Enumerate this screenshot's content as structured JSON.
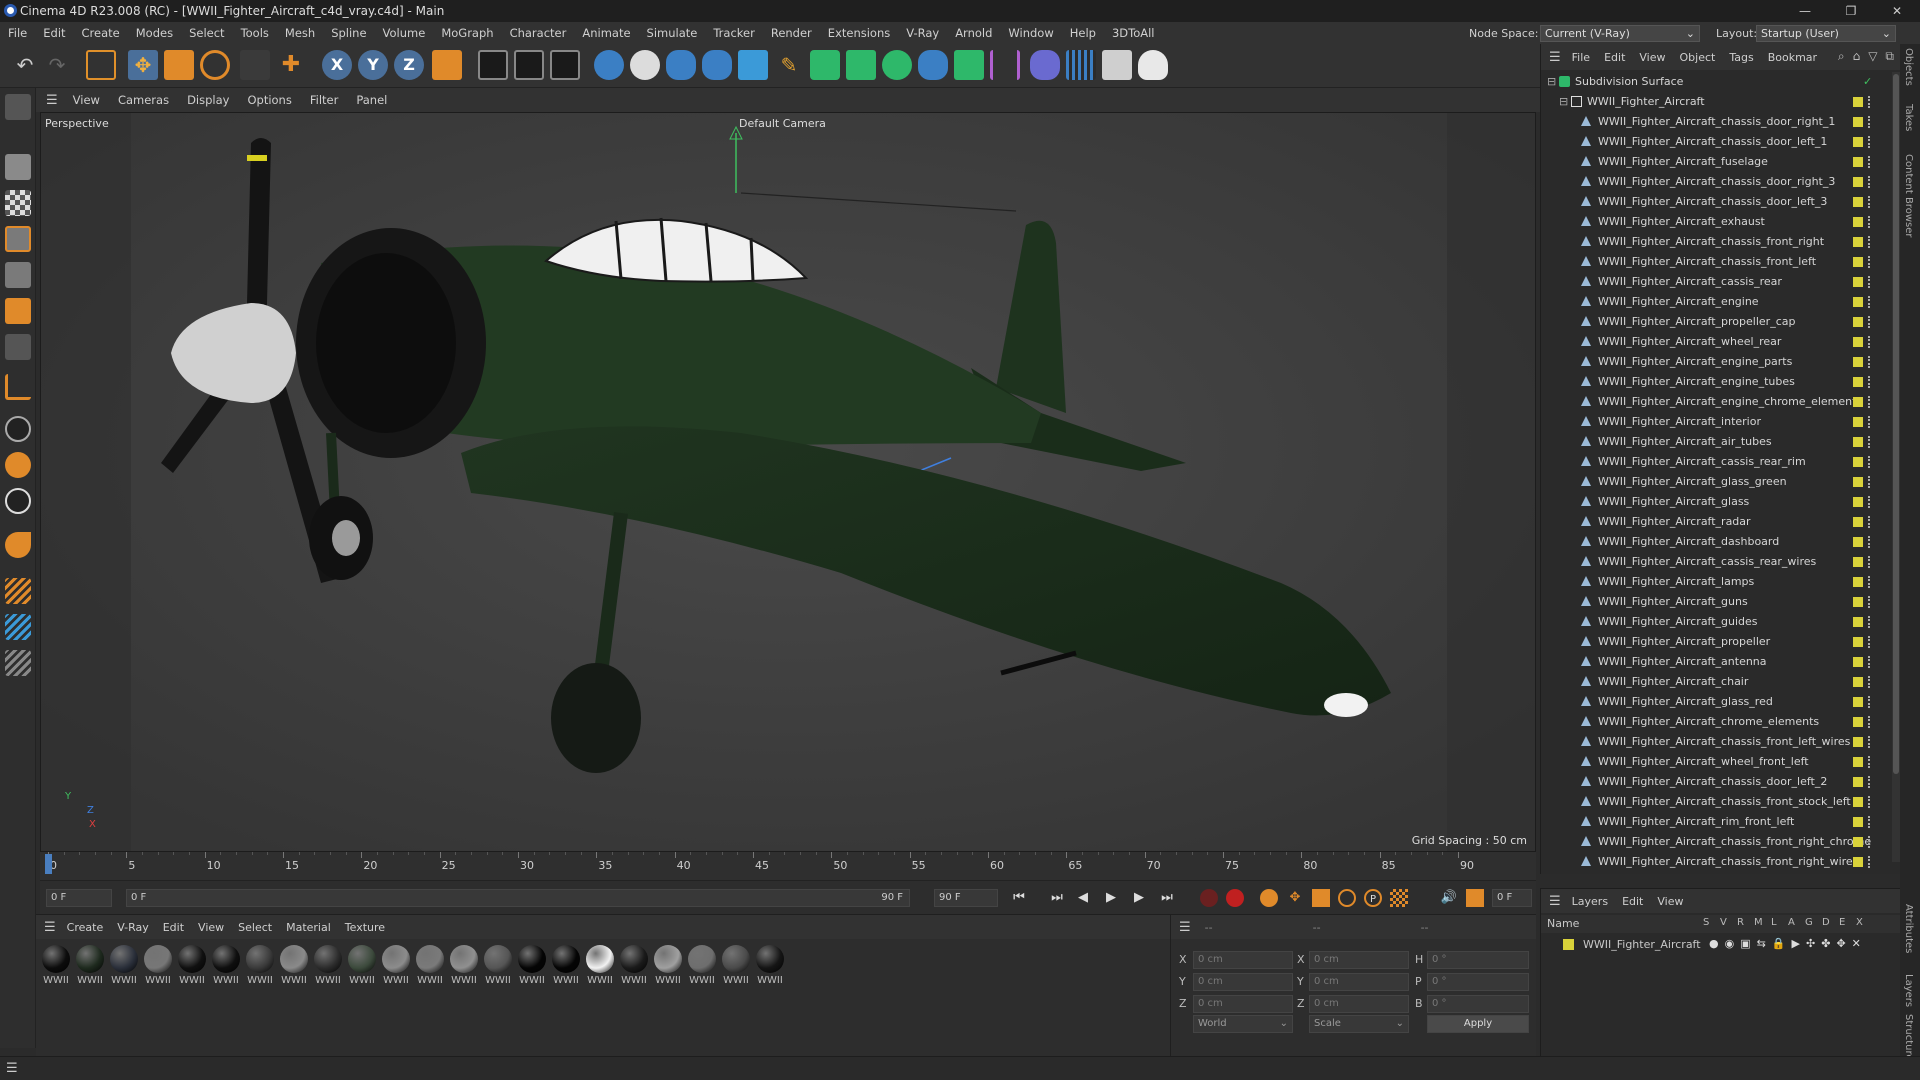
{
  "window": {
    "title": "Cinema 4D R23.008 (RC) - [WWII_Fighter_Aircraft_c4d_vray.c4d] - Main",
    "minimize": "—",
    "maximize": "❐",
    "close": "✕"
  },
  "menubar": {
    "items": [
      "File",
      "Edit",
      "Create",
      "Modes",
      "Select",
      "Tools",
      "Mesh",
      "Spline",
      "Volume",
      "MoGraph",
      "Character",
      "Animate",
      "Simulate",
      "Tracker",
      "Render",
      "Extensions",
      "V-Ray",
      "Arnold",
      "Window",
      "Help",
      "3DToAll"
    ],
    "node_space_label": "Node Space:",
    "node_space_value": "Current (V-Ray)",
    "layout_label": "Layout:",
    "layout_value": "Startup (User)"
  },
  "viewport": {
    "menu": [
      "View",
      "Cameras",
      "Display",
      "Options",
      "Filter",
      "Panel"
    ],
    "view_name": "Perspective",
    "camera_name": "Default Camera",
    "grid_spacing": "Grid Spacing : 50 cm",
    "axis_y": "Y",
    "axis_z": "Z",
    "axis_x": "X"
  },
  "timeline": {
    "ticks": [
      "0",
      "5",
      "10",
      "15",
      "20",
      "25",
      "30",
      "35",
      "40",
      "45",
      "50",
      "55",
      "60",
      "65",
      "70",
      "75",
      "80",
      "85",
      "90"
    ],
    "current_frame": "0 F",
    "start_field": "0 F",
    "range_start": "0 F",
    "range_end": "90 F",
    "end_field": "90 F",
    "max_field": "0 F",
    "playhead_fraction": 0
  },
  "materials": {
    "menu": [
      "Create",
      "V-Ray",
      "Edit",
      "View",
      "Select",
      "Material",
      "Texture"
    ],
    "items": [
      {
        "label": "WWII",
        "color": "#0c0c0c"
      },
      {
        "label": "WWII",
        "color": "#1e2a1e"
      },
      {
        "label": "WWII",
        "color": "#2a2f3a"
      },
      {
        "label": "WWII",
        "color": "#777777"
      },
      {
        "label": "WWII",
        "color": "#101010"
      },
      {
        "label": "WWII",
        "color": "#0f0f0f"
      },
      {
        "label": "WWII",
        "color": "#3a3a3a"
      },
      {
        "label": "WWII",
        "color": "#8a8a8a"
      },
      {
        "label": "WWII",
        "color": "#2c2c2c"
      },
      {
        "label": "WWII",
        "color": "#3c4a3c"
      },
      {
        "label": "WWII",
        "color": "#8c8c8c"
      },
      {
        "label": "WWII",
        "color": "#7a7a7a"
      },
      {
        "label": "WWII",
        "color": "#909090"
      },
      {
        "label": "WWII",
        "color": "#555555"
      },
      {
        "label": "WWII",
        "color": "#050505"
      },
      {
        "label": "WWII",
        "color": "#050505"
      },
      {
        "label": "WWII",
        "color": "#f2f2f2"
      },
      {
        "label": "WWII",
        "color": "#1a1a1a"
      },
      {
        "label": "WWII",
        "color": "#a0a0a0"
      },
      {
        "label": "WWII",
        "color": "#6e6e6e"
      },
      {
        "label": "WWII",
        "color": "#4a4a4a"
      },
      {
        "label": "WWII",
        "color": "#151515"
      }
    ]
  },
  "coordinates": {
    "header_a": "--",
    "header_b": "--",
    "header_c": "--",
    "rows": [
      {
        "a": "X",
        "av": "0 cm",
        "b": "X",
        "bv": "0 cm",
        "c": "H",
        "cv": "0 °"
      },
      {
        "a": "Y",
        "av": "0 cm",
        "b": "Y",
        "bv": "0 cm",
        "c": "P",
        "cv": "0 °"
      },
      {
        "a": "Z",
        "av": "0 cm",
        "b": "Z",
        "bv": "0 cm",
        "c": "B",
        "cv": "0 °"
      }
    ],
    "world": "World",
    "scale": "Scale",
    "apply": "Apply"
  },
  "objects": {
    "menu": [
      "File",
      "Edit",
      "View",
      "Object",
      "Tags",
      "Bookmar"
    ],
    "root": "Subdivision Surface",
    "group": "WWII_Fighter_Aircraft",
    "items": [
      "WWII_Fighter_Aircraft_chassis_door_right_1",
      "WWII_Fighter_Aircraft_chassis_door_left_1",
      "WWII_Fighter_Aircraft_fuselage",
      "WWII_Fighter_Aircraft_chassis_door_right_3",
      "WWII_Fighter_Aircraft_chassis_door_left_3",
      "WWII_Fighter_Aircraft_exhaust",
      "WWII_Fighter_Aircraft_chassis_front_right",
      "WWII_Fighter_Aircraft_chassis_front_left",
      "WWII_Fighter_Aircraft_cassis_rear",
      "WWII_Fighter_Aircraft_engine",
      "WWII_Fighter_Aircraft_propeller_cap",
      "WWII_Fighter_Aircraft_wheel_rear",
      "WWII_Fighter_Aircraft_engine_parts",
      "WWII_Fighter_Aircraft_engine_tubes",
      "WWII_Fighter_Aircraft_engine_chrome_elements",
      "WWII_Fighter_Aircraft_interior",
      "WWII_Fighter_Aircraft_air_tubes",
      "WWII_Fighter_Aircraft_cassis_rear_rim",
      "WWII_Fighter_Aircraft_glass_green",
      "WWII_Fighter_Aircraft_glass",
      "WWII_Fighter_Aircraft_radar",
      "WWII_Fighter_Aircraft_dashboard",
      "WWII_Fighter_Aircraft_cassis_rear_wires",
      "WWII_Fighter_Aircraft_lamps",
      "WWII_Fighter_Aircraft_guns",
      "WWII_Fighter_Aircraft_guides",
      "WWII_Fighter_Aircraft_propeller",
      "WWII_Fighter_Aircraft_antenna",
      "WWII_Fighter_Aircraft_chair",
      "WWII_Fighter_Aircraft_glass_red",
      "WWII_Fighter_Aircraft_chrome_elements",
      "WWII_Fighter_Aircraft_chassis_front_left_wires",
      "WWII_Fighter_Aircraft_wheel_front_left",
      "WWII_Fighter_Aircraft_chassis_door_left_2",
      "WWII_Fighter_Aircraft_chassis_front_stock_left",
      "WWII_Fighter_Aircraft_rim_front_left",
      "WWII_Fighter_Aircraft_chassis_front_right_chrome",
      "WWII_Fighter_Aircraft_chassis_front_right_wires"
    ]
  },
  "layers": {
    "menu": [
      "Layers",
      "Edit",
      "View"
    ],
    "col_name": "Name",
    "cols": [
      "S",
      "V",
      "R",
      "M",
      "L",
      "A",
      "G",
      "D",
      "E",
      "X"
    ],
    "item": "WWII_Fighter_Aircraft"
  },
  "sidetabs": [
    "Objects",
    "Takes",
    "Content Browser",
    "Attributes",
    "Layers",
    "Structure"
  ]
}
